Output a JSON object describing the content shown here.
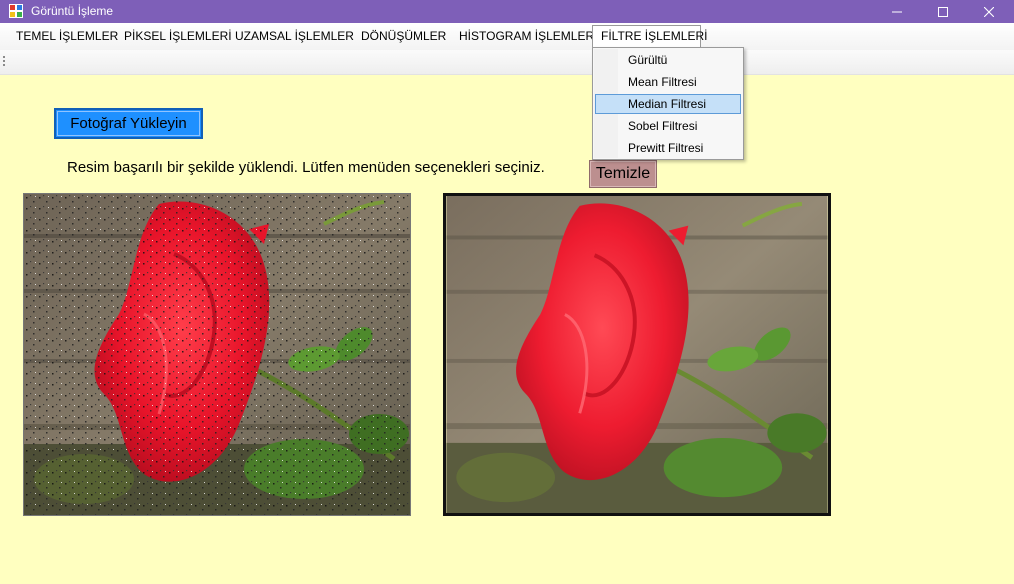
{
  "window": {
    "title": "Görüntü İşleme",
    "icon": "app-window-icon"
  },
  "menu": {
    "items": [
      "TEMEL İŞLEMLER",
      "PİKSEL İŞLEMLERİ",
      "UZAMSAL İŞLEMLER",
      "DÖNÜŞÜMLER",
      "HİSTOGRAM İŞLEMLERİ",
      "FİLTRE İŞLEMLERİ"
    ],
    "open_menu": "FİLTRE İŞLEMLERİ"
  },
  "dropdown": {
    "items": [
      "Gürültü",
      "Mean Filtresi",
      "Median Filtresi",
      "Sobel Filtresi",
      "Prewitt Filtresi"
    ],
    "selected": "Median Filtresi"
  },
  "main": {
    "upload_label": "Fotoğraf Yükleyin",
    "status": "Resim başarılı bir şekilde yüklendi. Lütfen menüden seçenekleri seçiniz.",
    "clear_label": "Temizle"
  },
  "images": {
    "original": "noisy-red-rose-photo",
    "processed": "median-filtered-red-rose-photo"
  },
  "colors": {
    "titlebar": "#7E5FB8",
    "background": "#FFFFC0",
    "upload_button": "#1E90FF",
    "clear_button": "#BC8F8F",
    "menu_selected": "#C5E0F8"
  }
}
